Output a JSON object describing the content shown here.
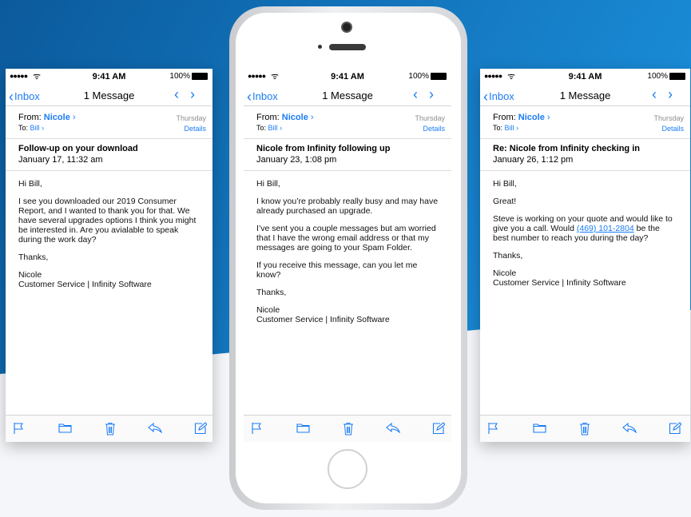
{
  "colors": {
    "accent": "#1a7cf5",
    "background_top": "#0d5ea3",
    "background_bottom": "#f4f6f9"
  },
  "status": {
    "signal": "●●●●●",
    "wifi_icon": "wifi-icon",
    "time": "9:41 AM",
    "battery": "100%"
  },
  "nav": {
    "back": "Inbox",
    "title": "1 Message"
  },
  "header_labels": {
    "from": "From:",
    "to": "To:",
    "details": "Details"
  },
  "screens": [
    {
      "from_name": "Nicole",
      "to_name": "Bill",
      "day": "Thursday",
      "subject": "Follow-up on your download",
      "date": "January 17, 11:32 am",
      "greeting": "Hi Bill,",
      "paragraphs": [
        "I see you downloaded our 2019 Consumer Report, and I wanted to thank you for that. We have several upgrades options I think you might be interested in. Are you avialable to speak during the work day?"
      ],
      "closing": "Thanks,",
      "signature_name": "Nicole",
      "signature_title": "Customer Service | Infinity Software"
    },
    {
      "from_name": "Nicole",
      "to_name": "Bill",
      "day": "Thursday",
      "subject": "Nicole from Infinity following up",
      "date": "January 23, 1:08 pm",
      "greeting": "Hi Bill,",
      "paragraphs": [
        "I know you’re probably really busy and may have already purchased an upgrade.",
        "I’ve sent you a couple messages but am worried that I have the wrong email address or that my messages are going to your Spam Folder.",
        "If you receive this message, can you let me know?"
      ],
      "closing": "Thanks,",
      "signature_name": "Nicole",
      "signature_title": "Customer Service | Infinity Software"
    },
    {
      "from_name": "Nicole",
      "to_name": "Bill",
      "day": "Thursday",
      "subject": "Re: Nicole from Infinity checking in",
      "date": "January 26, 1:12 pm",
      "greeting": "Hi Bill,",
      "paragraphs": [
        "Great!"
      ],
      "para_pre": "Steve is working on your quote and would like to give you a call. Would ",
      "phone": "(469) 101-2804",
      "para_post": " be the best number to reach you during the day?",
      "closing": "Thanks,",
      "signature_name": "Nicole",
      "signature_title": "Customer Service | Infinity Software"
    }
  ],
  "toolbar_icons": [
    "flag-icon",
    "folder-icon",
    "trash-icon",
    "reply-icon",
    "compose-icon"
  ]
}
